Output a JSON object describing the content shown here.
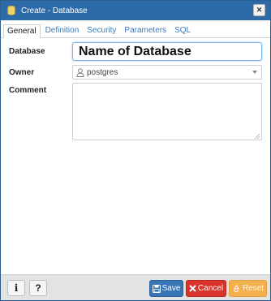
{
  "dialog": {
    "title": "Create - Database",
    "close_glyph": "✕"
  },
  "tabs": [
    {
      "label": "General",
      "active": true
    },
    {
      "label": "Definition",
      "active": false
    },
    {
      "label": "Security",
      "active": false
    },
    {
      "label": "Parameters",
      "active": false
    },
    {
      "label": "SQL",
      "active": false
    }
  ],
  "form": {
    "database_label": "Database",
    "database_value": "Name of Database",
    "owner_label": "Owner",
    "owner_value": "postgres",
    "comment_label": "Comment",
    "comment_value": ""
  },
  "footer": {
    "info_label": "i",
    "help_label": "?",
    "save_label": "Save",
    "cancel_label": "Cancel",
    "reset_label": "Reset"
  },
  "icons": {
    "title": "database-icon",
    "close": "close-icon",
    "owner": "user-icon",
    "save": "save-icon",
    "cancel": "cancel-icon",
    "reset": "reset-icon"
  },
  "colors": {
    "titlebar": "#2c6ba8",
    "save": "#3775b5",
    "cancel": "#d9342b",
    "reset": "#f3b04f"
  }
}
